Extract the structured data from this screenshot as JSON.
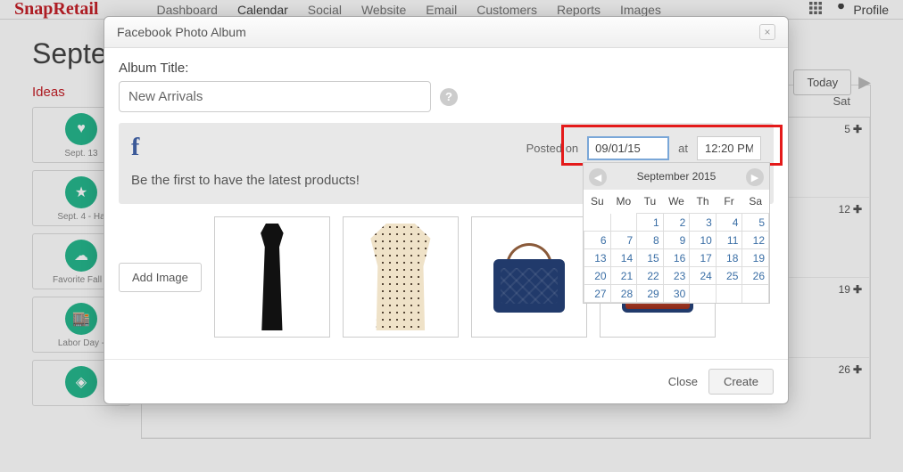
{
  "topnav": {
    "logo_main": "SnapRetail",
    "items": [
      "Dashboard",
      "Calendar",
      "Social",
      "Website",
      "Email",
      "Customers",
      "Reports",
      "Images"
    ],
    "active_index": 1,
    "profile": "Profile"
  },
  "page": {
    "month_heading": "Septe",
    "today_btn": "Today",
    "ideas_heading": "Ideas",
    "day_headers": [
      "Sat"
    ],
    "week_days": [
      "5",
      "12",
      "19",
      "26"
    ],
    "idea_cards": [
      {
        "label": "Sept. 13"
      },
      {
        "label": "Sept. 4 - Ha"
      },
      {
        "label": "Favorite Fall A"
      },
      {
        "label": "Labor Day -"
      },
      {
        "label": ""
      }
    ]
  },
  "modal": {
    "title": "Facebook Photo Album",
    "album_label": "Album Title:",
    "album_value": "New Arrivals",
    "posted_on_label": "Posted on",
    "at_label": "at",
    "date_value": "09/01/15",
    "time_value": "12:20 PM",
    "post_text": "Be the first to have the latest products!",
    "add_image_btn": "Add Image",
    "close_btn": "Close",
    "create_btn": "Create"
  },
  "datepicker": {
    "heading": "September 2015",
    "dow": [
      "Su",
      "Mo",
      "Tu",
      "We",
      "Th",
      "Fr",
      "Sa"
    ],
    "weeks": [
      [
        "",
        "",
        "1",
        "2",
        "3",
        "4",
        "5"
      ],
      [
        "6",
        "7",
        "8",
        "9",
        "10",
        "11",
        "12"
      ],
      [
        "13",
        "14",
        "15",
        "16",
        "17",
        "18",
        "19"
      ],
      [
        "20",
        "21",
        "22",
        "23",
        "24",
        "25",
        "26"
      ],
      [
        "27",
        "28",
        "29",
        "30",
        "",
        "",
        ""
      ]
    ]
  },
  "chart_data": null
}
